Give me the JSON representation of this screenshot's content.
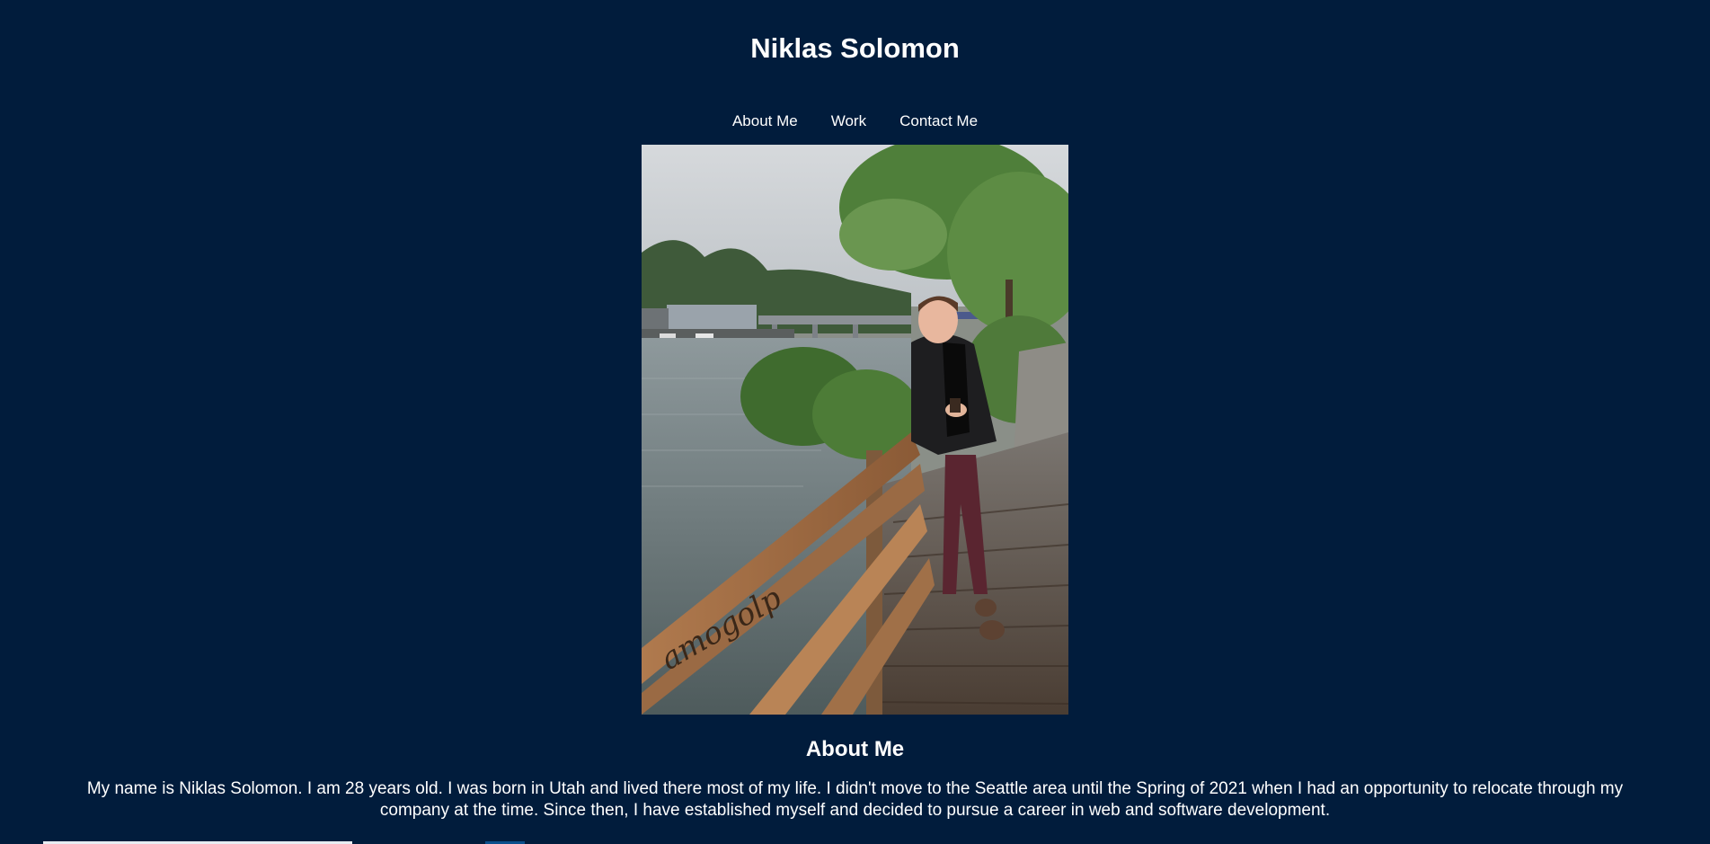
{
  "header": {
    "title": "Niklas Solomon"
  },
  "nav": {
    "items": [
      {
        "label": "About Me"
      },
      {
        "label": "Work"
      },
      {
        "label": "Contact Me"
      }
    ]
  },
  "photo": {
    "graffiti_text": "amogolp"
  },
  "about": {
    "heading": "About Me",
    "body": "My name is Niklas Solomon. I am 28 years old. I was born in Utah and lived there most of my life. I didn't move to the Seattle area until the Spring of 2021 when I had an opportunity to relocate through my company at the time. Since then, I have established myself and decided to pursue a career in web and software development."
  },
  "colors": {
    "background": "#011c3c",
    "text": "#ffffff"
  }
}
